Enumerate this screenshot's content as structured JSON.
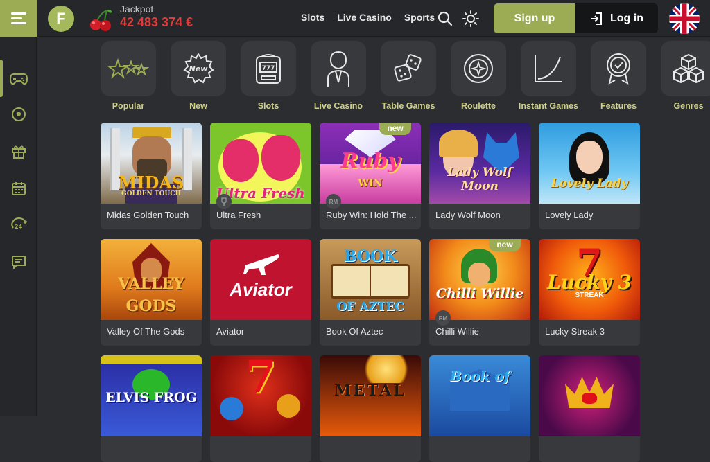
{
  "header": {
    "logo_letter": "F",
    "jackpot_label": "Jackpot",
    "jackpot_value": "42 483 374 €",
    "nav": [
      "Slots",
      "Live Casino",
      "Sports"
    ],
    "signup_label": "Sign up",
    "login_label": "Log in",
    "language_flag": "uk-flag-icon"
  },
  "sidebar": {
    "items": [
      "gamepad-icon",
      "football-icon",
      "gift-icon",
      "calendar-icon",
      "support-24-icon",
      "chat-icon"
    ]
  },
  "categories": [
    {
      "label": "Popular",
      "icon": "stars-icon"
    },
    {
      "label": "New",
      "icon": "new-badge-icon"
    },
    {
      "label": "Slots",
      "icon": "slot-machine-icon"
    },
    {
      "label": "Live Casino",
      "icon": "dealer-icon"
    },
    {
      "label": "Table Games",
      "icon": "dice-icon"
    },
    {
      "label": "Roulette",
      "icon": "roulette-icon"
    },
    {
      "label": "Instant Games",
      "icon": "growth-curve-icon"
    },
    {
      "label": "Features",
      "icon": "award-icon"
    },
    {
      "label": "Genres",
      "icon": "cubes-icon"
    }
  ],
  "games": [
    {
      "name": "Midas Golden Touch",
      "art": "MIDAS",
      "art2": "GOLDEN TOUCH"
    },
    {
      "name": "Ultra Fresh",
      "art": "Ultra Fresh"
    },
    {
      "name": "Ruby Win: Hold The ...",
      "art": "Ruby",
      "art2": "WIN",
      "badge": "new"
    },
    {
      "name": "Lady Wolf Moon",
      "art": "Lady Wolf",
      "art2": "Moon"
    },
    {
      "name": "Lovely Lady",
      "art": "Lovely Lady"
    },
    {
      "name": "Valley Of The Gods",
      "art": "VALLEY",
      "art2": "GODS"
    },
    {
      "name": "Aviator",
      "art": "Aviator"
    },
    {
      "name": "Book Of Aztec",
      "art": "BOOK",
      "art2": "OF AZTEC"
    },
    {
      "name": "Chilli Willie",
      "art": "Chilli Willie",
      "badge": "new"
    },
    {
      "name": "Lucky Streak 3",
      "art": "Lucky 3",
      "art2": "STREAK"
    },
    {
      "name": "",
      "art": "ELVIS FROG"
    },
    {
      "name": "",
      "art": "7"
    },
    {
      "name": "",
      "art": "METAL"
    },
    {
      "name": "",
      "art": "Book of"
    },
    {
      "name": "",
      "art": ""
    }
  ],
  "colors": {
    "accent": "#9bac55",
    "background": "#2b2d30",
    "card": "#37393d",
    "jackpot": "#e23b3b",
    "category_label": "#cfd08a"
  }
}
